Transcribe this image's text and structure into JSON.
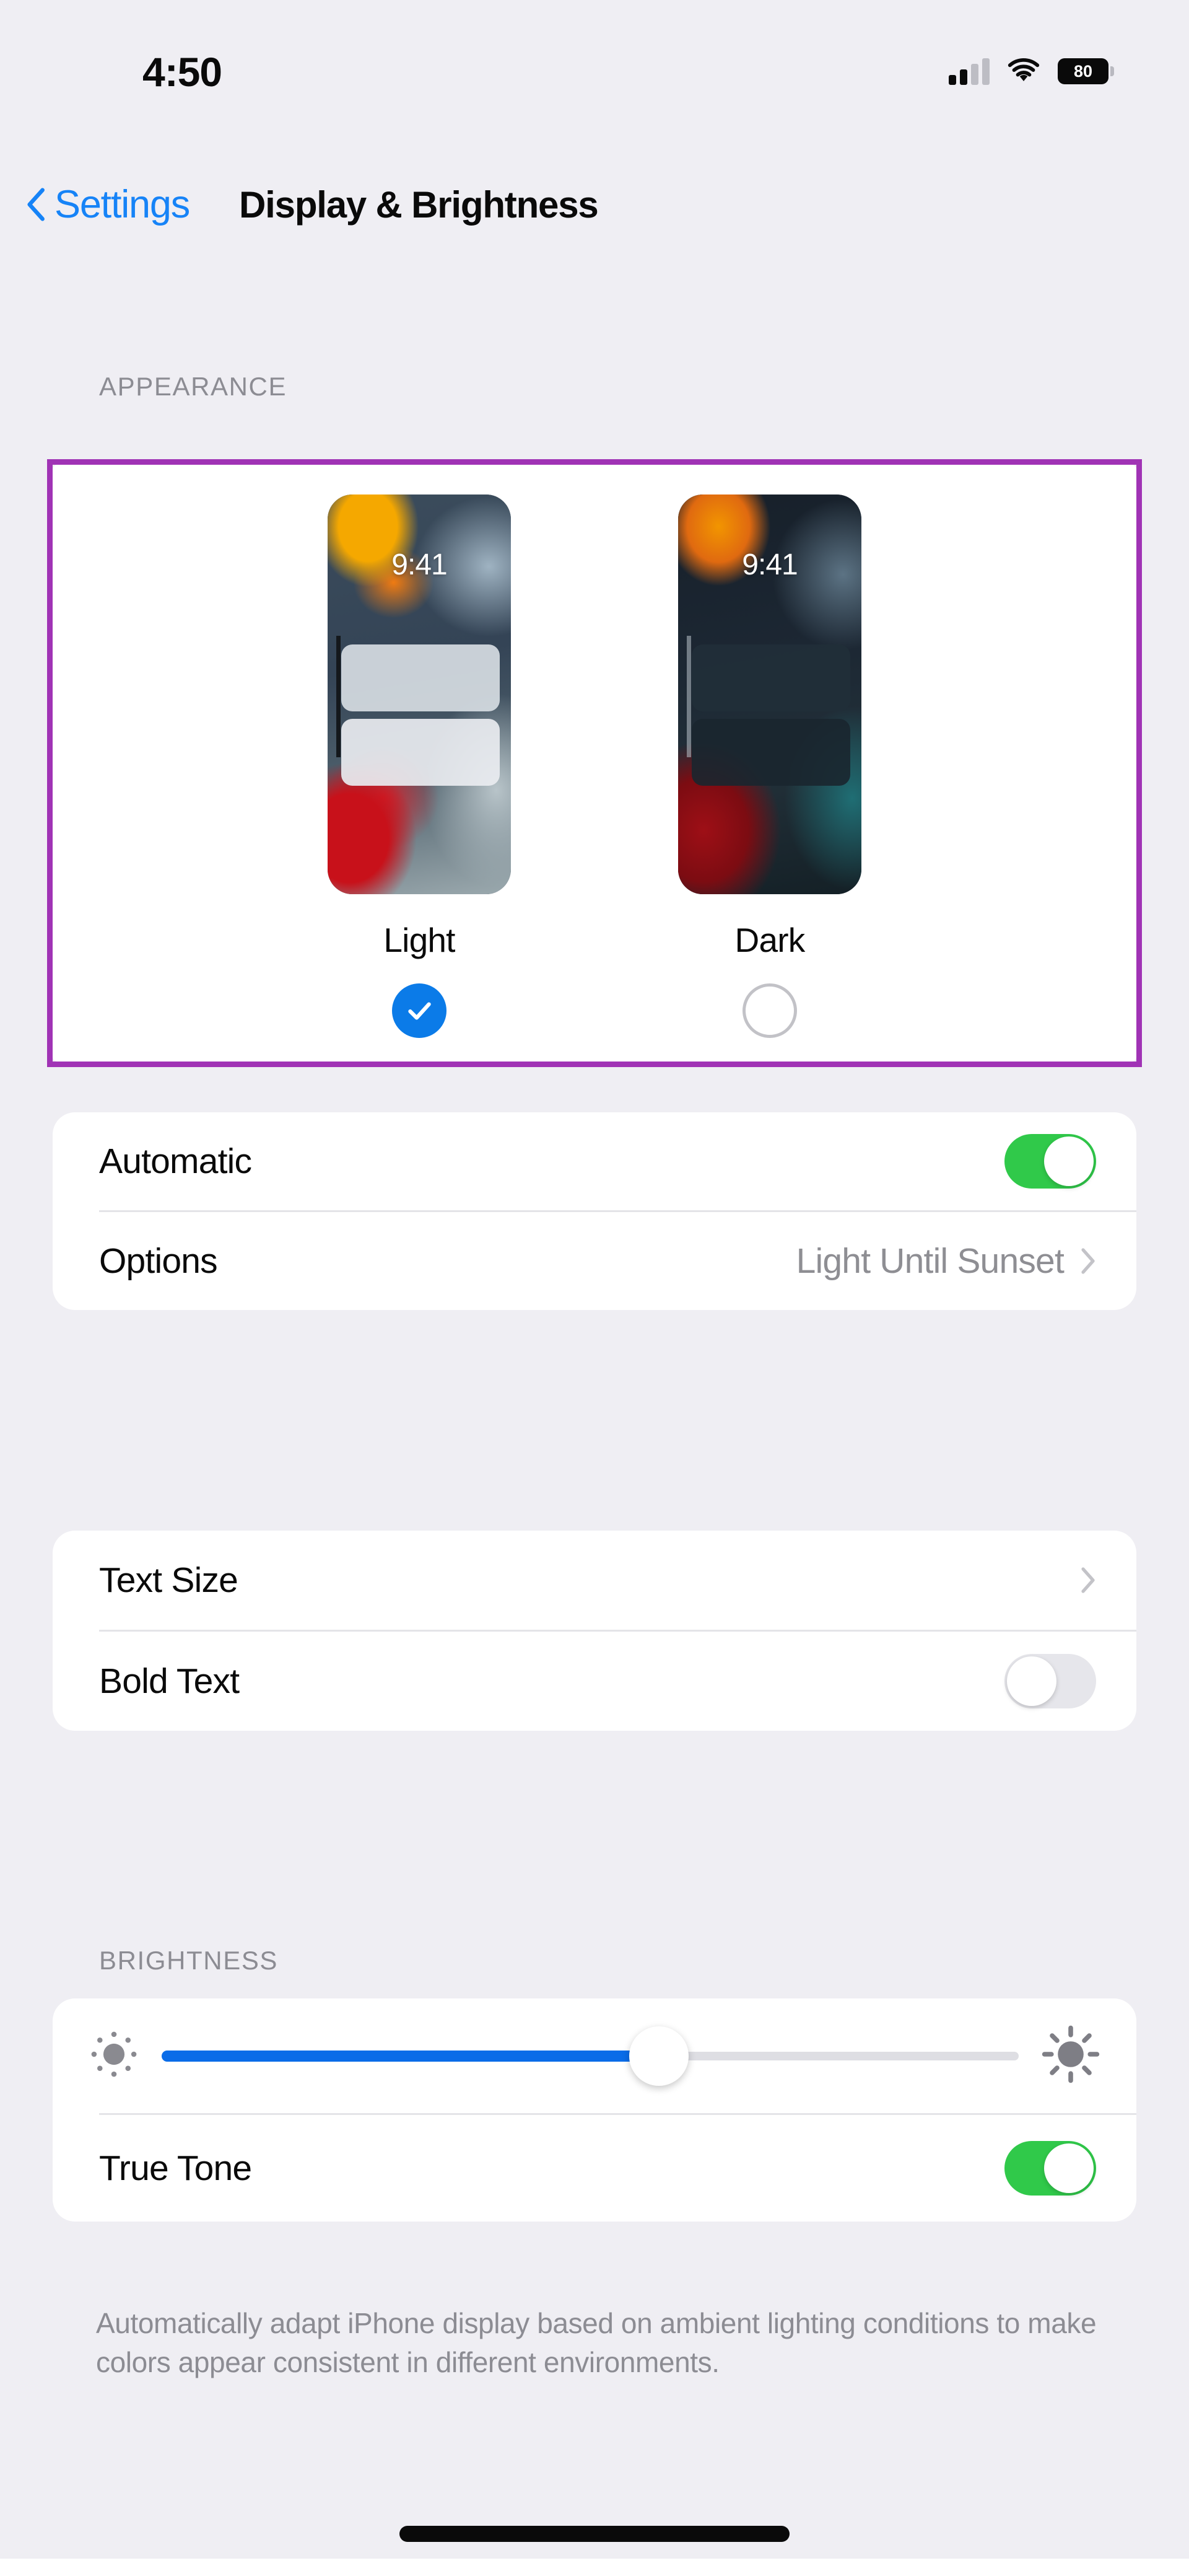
{
  "status_bar": {
    "time": "4:50",
    "signal_icon": "cellular-signal-icon",
    "wifi_icon": "wifi-icon",
    "battery_icon": "battery-icon",
    "battery_level": "80"
  },
  "nav": {
    "back_icon": "chevron-left-icon",
    "back_label": "Settings",
    "title": "Display & Brightness"
  },
  "appearance": {
    "header": "APPEARANCE",
    "options": [
      {
        "name": "Light",
        "preview_time": "9:41",
        "selected": true,
        "check_icon": "checkmark-icon"
      },
      {
        "name": "Dark",
        "preview_time": "9:41",
        "selected": false,
        "check_icon": "radio-empty-icon"
      }
    ],
    "automatic": {
      "label": "Automatic",
      "state": "on"
    },
    "options_row": {
      "label": "Options",
      "value": "Light Until Sunset",
      "chevron_icon": "chevron-right-icon"
    }
  },
  "text_section": {
    "text_size": {
      "label": "Text Size",
      "chevron_icon": "chevron-right-icon"
    },
    "bold_text": {
      "label": "Bold Text",
      "state": "off"
    }
  },
  "brightness": {
    "header": "BRIGHTNESS",
    "low_icon": "sun-low-icon",
    "high_icon": "sun-high-icon",
    "value_percent": "58",
    "true_tone": {
      "label": "True Tone",
      "state": "on"
    },
    "footer": "Automatically adapt iPhone display based on ambient lighting conditions to make colors appear consistent in different environments."
  },
  "home_indicator": "home-indicator",
  "colors": {
    "accent_blue": "#0B7BE8",
    "link_blue": "#1683F7",
    "toggle_green": "#30C94A",
    "highlight_purple": "#A033B5",
    "page_bg": "#EFEEF3",
    "card_bg": "#FFFFFF",
    "secondary_text": "#8E8E93"
  }
}
